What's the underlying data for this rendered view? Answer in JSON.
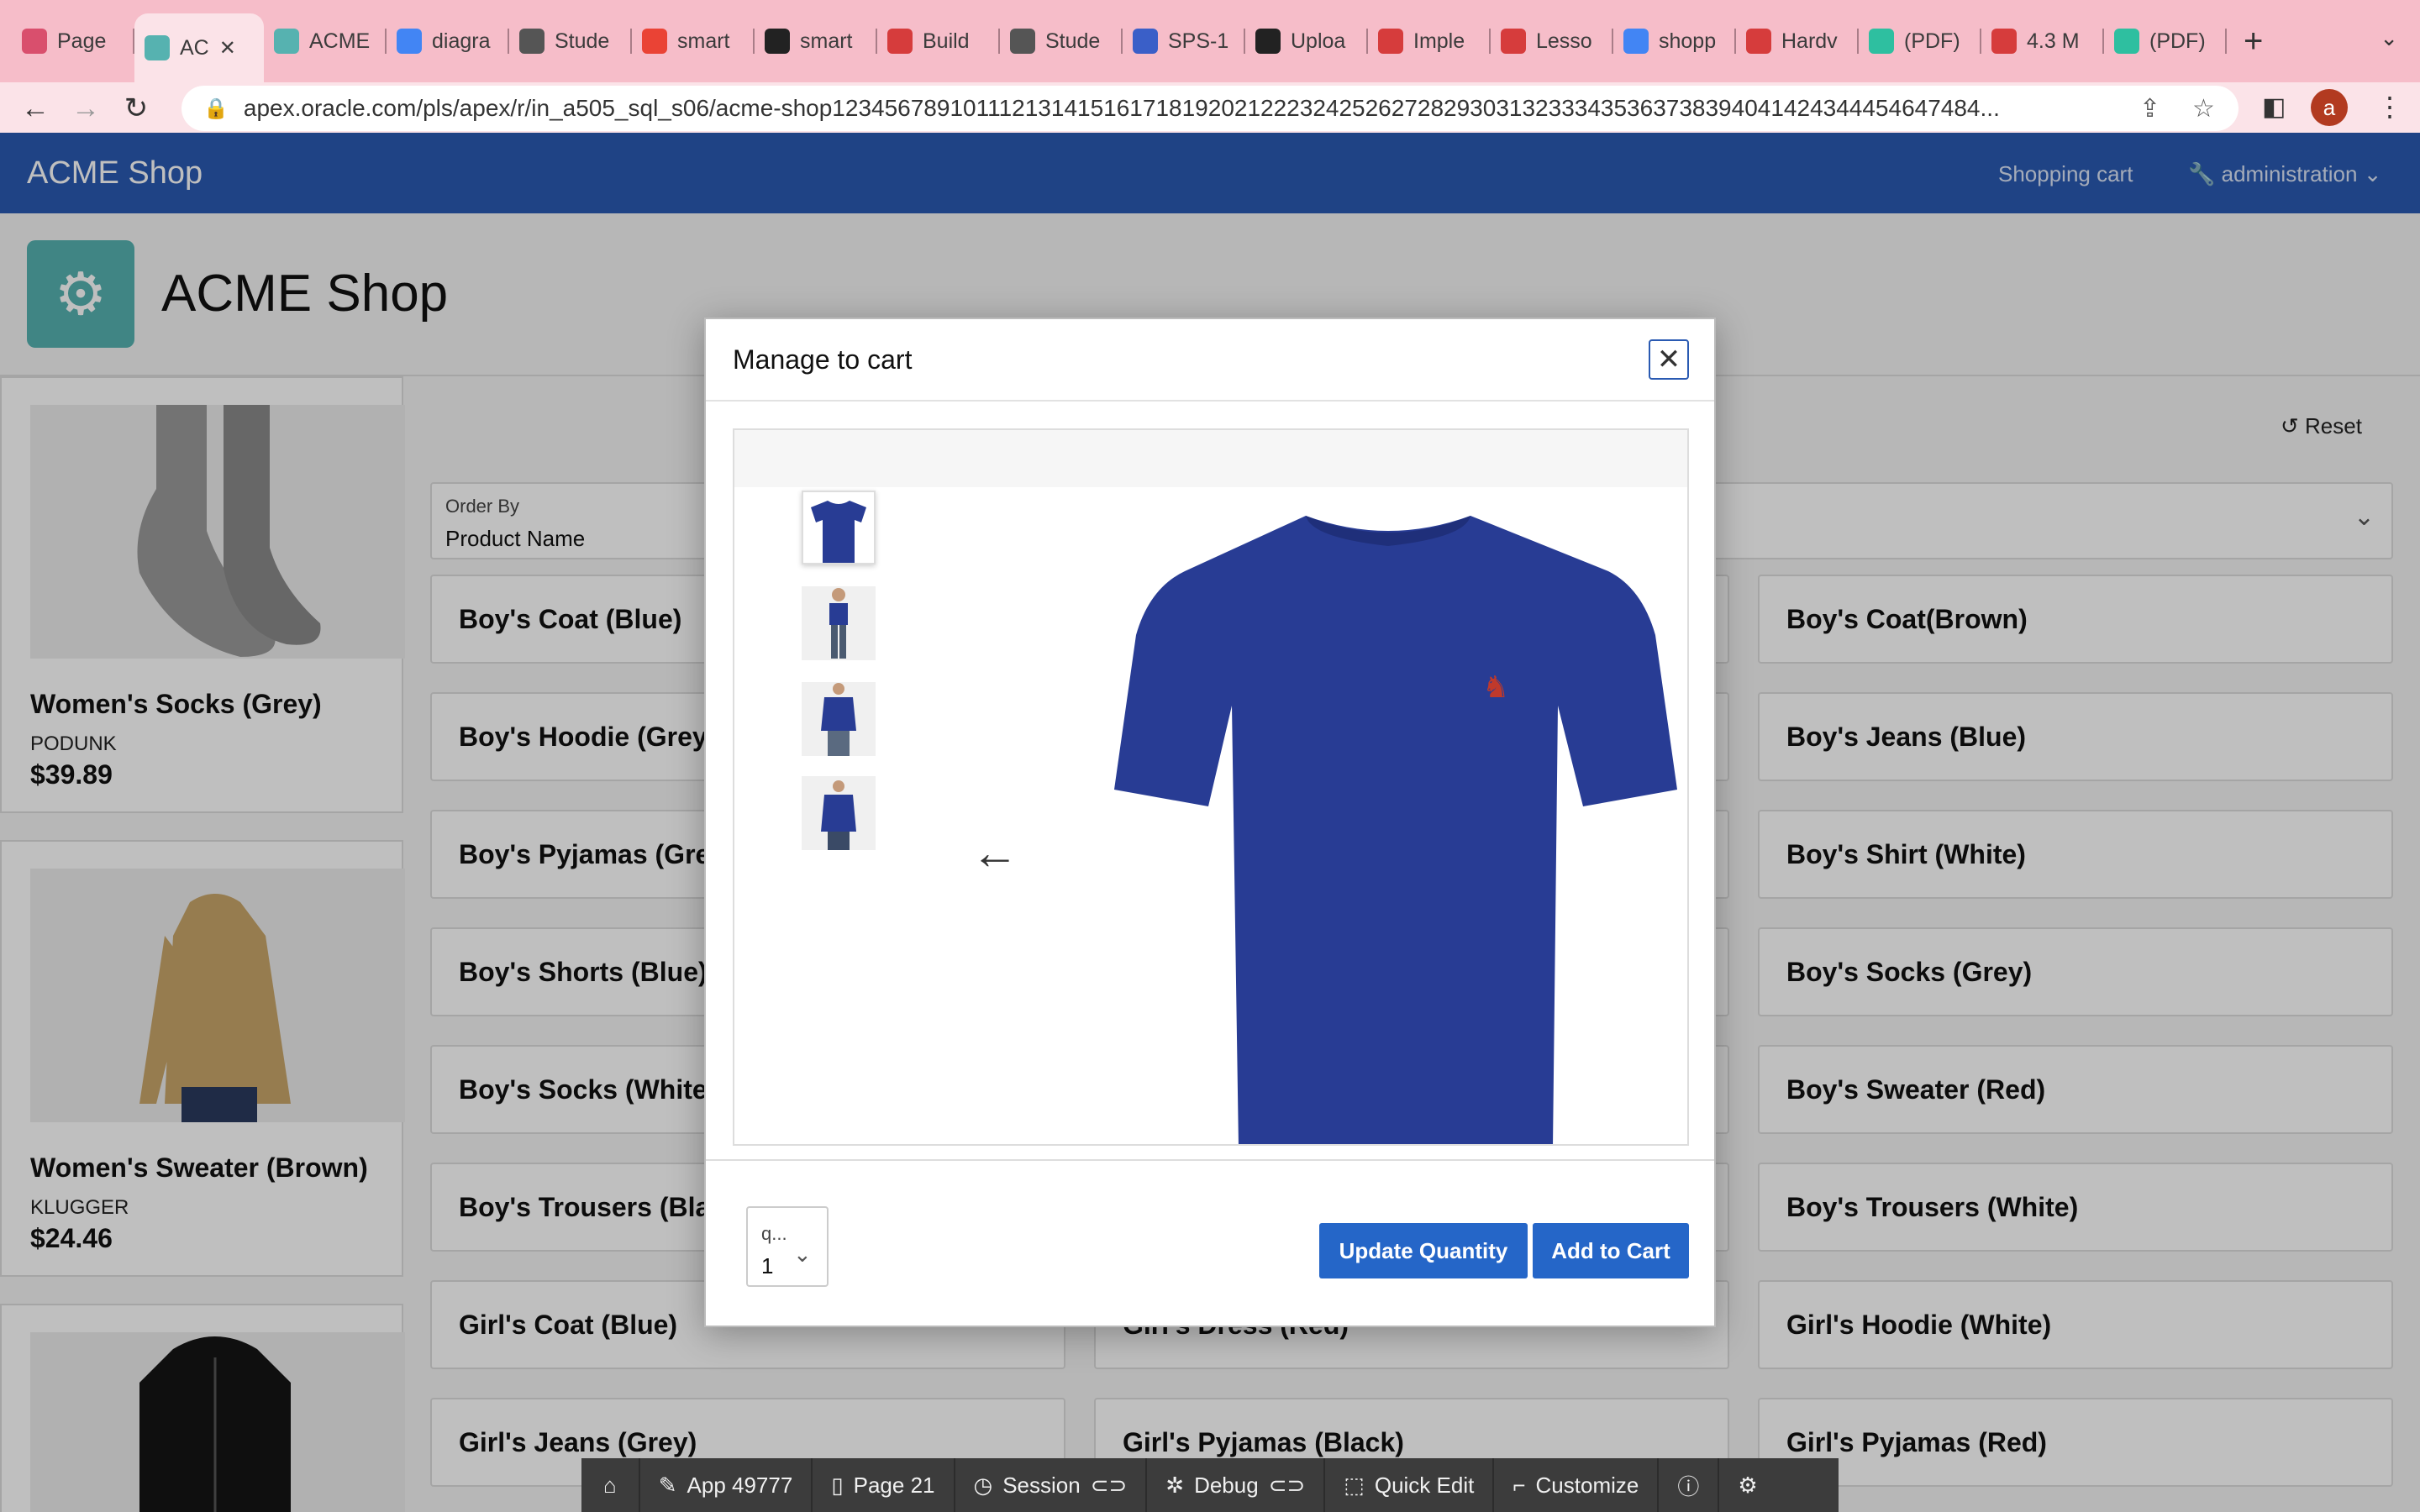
{
  "browser": {
    "tabs": [
      {
        "label": "Page",
        "favicon_color": "#d94f6d"
      },
      {
        "label": "AC",
        "favicon_color": "#56b2b0"
      },
      {
        "label": "ACME",
        "favicon_color": "#56b2b0"
      },
      {
        "label": "diagra",
        "favicon_color": "#4285f4"
      },
      {
        "label": "Stude",
        "favicon_color": "#555555"
      },
      {
        "label": "smart",
        "favicon_color": "#ea4335"
      },
      {
        "label": "smart",
        "favicon_color": "#222222"
      },
      {
        "label": "Build",
        "favicon_color": "#d63c3c"
      },
      {
        "label": "Stude",
        "favicon_color": "#555555"
      },
      {
        "label": "SPS-1",
        "favicon_color": "#3a5fc8"
      },
      {
        "label": "Uploa",
        "favicon_color": "#222222"
      },
      {
        "label": "Imple",
        "favicon_color": "#d63c3c"
      },
      {
        "label": "Lesso",
        "favicon_color": "#d63c3c"
      },
      {
        "label": "shopp",
        "favicon_color": "#4285f4"
      },
      {
        "label": "Hardv",
        "favicon_color": "#d63c3c"
      },
      {
        "label": "(PDF)",
        "favicon_color": "#2ebfa0"
      },
      {
        "label": "4.3 M",
        "favicon_color": "#d63c3c"
      },
      {
        "label": "(PDF)",
        "favicon_color": "#2ebfa0"
      }
    ],
    "url": "apex.oracle.com/pls/apex/r/in_a505_sql_s06/acme-shop1234567891011121314151617181920212223242526272829303132333435363738394041424344454647484...",
    "profile_initial": "a"
  },
  "app": {
    "brand": "ACME Shop",
    "nav_cart": "Shopping cart",
    "nav_admin": "administration",
    "page_title": "ACME Shop",
    "reset_label": "Reset",
    "order_by_label": "Order By",
    "order_by_value": "Product Name"
  },
  "left_cards": [
    {
      "name": "Women's Socks (Grey)",
      "brand": "PODUNK",
      "price": "$39.89"
    },
    {
      "name": "Women's Sweater (Brown)",
      "brand": "KLUGGER",
      "price": "$24.46"
    },
    {
      "name": "",
      "brand": "",
      "price": ""
    }
  ],
  "products": [
    [
      "Boy's Coat (Blue)",
      "",
      "Boy's Coat(Brown)"
    ],
    [
      "Boy's Hoodie (Grey",
      "",
      "Boy's Jeans (Blue)"
    ],
    [
      "Boy's Pyjamas (Gre",
      "",
      "Boy's Shirt (White)"
    ],
    [
      "Boy's Shorts (Blue)",
      "",
      "Boy's Socks (Grey)"
    ],
    [
      "Boy's Socks (White",
      "",
      "Boy's Sweater (Red)"
    ],
    [
      "Boy's Trousers (Bla",
      "",
      "Boy's Trousers (White)"
    ],
    [
      "Girl's Coat (Blue)",
      "Girl's Dress (Red)",
      "Girl's Hoodie (White)"
    ],
    [
      "Girl's Jeans (Grey)",
      "Girl's Pyjamas (Black)",
      "Girl's Pyjamas (Red)"
    ]
  ],
  "dialog": {
    "title": "Manage to cart",
    "qty_label": "q...",
    "qty_value": "1",
    "update_btn": "Update Quantity",
    "add_btn": "Add to Cart"
  },
  "devbar": {
    "app": "App 49777",
    "page": "Page 21",
    "session": "Session",
    "debug": "Debug",
    "quick_edit": "Quick Edit",
    "customize": "Customize"
  },
  "colors": {
    "header_blue": "#2a5ab2",
    "button_blue": "#2566c8",
    "shirt_navy": "#283c94",
    "app_icon_teal": "#56b2b0"
  }
}
